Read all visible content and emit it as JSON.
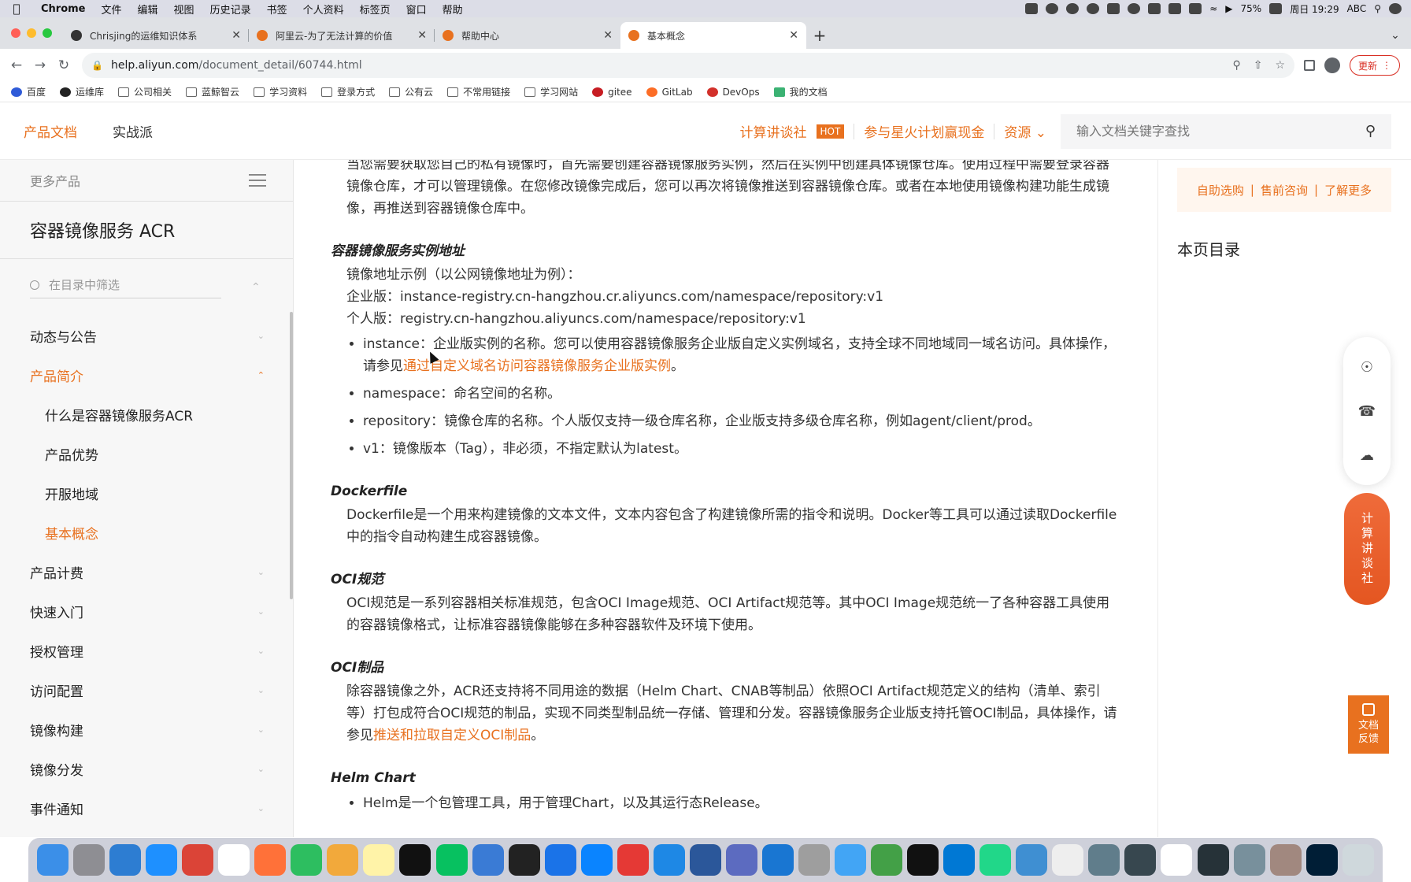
{
  "menubar": {
    "app": "Chrome",
    "items": [
      "文件",
      "编辑",
      "视图",
      "历史记录",
      "书签",
      "个人资料",
      "标签页",
      "窗口",
      "帮助"
    ],
    "battery": "75%",
    "input_method": "ABC",
    "clock": "周日 19:29"
  },
  "tabs": [
    {
      "title": "Chrisjing的运维知识体系",
      "favicon_color": "#333333"
    },
    {
      "title": "阿里云-为了无法计算的价值",
      "favicon_color": "#e8711f"
    },
    {
      "title": "帮助中心",
      "favicon_color": "#e8711f"
    },
    {
      "title": "基本概念",
      "favicon_color": "#e8711f"
    }
  ],
  "address": {
    "host": "help.aliyun.com",
    "path": "/document_detail/60744.html",
    "update_label": "更新"
  },
  "bookmarks": [
    "百度",
    "运维库",
    "公司相关",
    "蓝鲸智云",
    "学习资料",
    "登录方式",
    "公有云",
    "不常用链接",
    "学习网站",
    "gitee",
    "GitLab",
    "DevOps",
    "我的文档"
  ],
  "header": {
    "nav": [
      "产品文档",
      "实战派"
    ],
    "promo1": "计算讲谈社",
    "hot": "HOT",
    "promo2": "参与星火计划赢现金",
    "resources": "资源",
    "search_placeholder": "输入文档关键字查找"
  },
  "sidebar": {
    "more_products": "更多产品",
    "product_title": "容器镜像服务 ACR",
    "filter_placeholder": "在目录中筛选",
    "items": [
      {
        "label": "动态与公告"
      },
      {
        "label": "产品简介"
      },
      {
        "label": "产品计费"
      },
      {
        "label": "快速入门"
      },
      {
        "label": "授权管理"
      },
      {
        "label": "访问配置"
      },
      {
        "label": "镜像构建"
      },
      {
        "label": "镜像分发"
      },
      {
        "label": "事件通知"
      }
    ],
    "sub_items": [
      "什么是容器镜像服务ACR",
      "产品优势",
      "开服地域",
      "基本概念"
    ]
  },
  "content": {
    "intro": "当您需要获取您自己的私有镜像时，首先需要创建容器镜像服务实例，然后在实例中创建具体镜像仓库。使用过程中需要登录容器镜像仓库，才可以管理镜像。在您修改镜像完成后，您可以再次将镜像推送到容器镜像仓库。或者在本地使用镜像构建功能生成镜像，再推送到容器镜像仓库中。",
    "h_instance": "容器镜像服务实例地址",
    "example_intro": "镜像地址示例（以公网镜像地址为例）：",
    "enterprise": "企业版：instance-registry.cn-hangzhou.cr.aliyuncs.com/namespace/repository:v1",
    "personal": "个人版：registry.cn-hangzhou.aliyuncs.com/namespace/repository:v1",
    "li_instance": "instance：企业版实例的名称。您可以使用容器镜像服务企业版自定义实例域名，支持全球不同地域同一域名访问。具体操作，请参见",
    "li_instance_link": "通过自定义域名访问容器镜像服务企业版实例",
    "li_namespace": "namespace：命名空间的名称。",
    "li_repository": "repository：镜像仓库的名称。个人版仅支持一级仓库名称，企业版支持多级仓库名称，例如agent/client/prod。",
    "li_v1": "v1：镜像版本（Tag），非必须，不指定默认为latest。",
    "h_dockerfile": "Dockerfile",
    "dockerfile": "Dockerfile是一个用来构建镜像的文本文件，文本内容包含了构建镜像所需的指令和说明。Docker等工具可以通过读取Dockerfile中的指令自动构建生成容器镜像。",
    "h_oci": "OCI规范",
    "oci": "OCI规范是一系列容器相关标准规范，包含OCI Image规范、OCI Artifact规范等。其中OCI Image规范统一了各种容器工具使用的容器镜像格式，让标准容器镜像能够在多种容器软件及环境下使用。",
    "h_oci_artifact": "OCI制品",
    "oci_artifact": "除容器镜像之外，ACR还支持将不同用途的数据（Helm Chart、CNAB等制品）依照OCI Artifact规范定义的结构（清单、索引等）打包成符合OCI规范的制品，实现不同类型制品统一存储、管理和分发。容器镜像服务企业版支持托管OCI制品，具体操作，请参见",
    "oci_artifact_link": "推送和拉取自定义OCI制品",
    "h_helm": "Helm Chart",
    "li_helm": "Helm是一个包管理工具，用于管理Chart，以及其运行态Release。"
  },
  "right": {
    "links": [
      "自助选购",
      "售前咨询",
      "了解更多"
    ],
    "toc_title": "本页目录",
    "talk": "计算讲谈社",
    "feedback": "文档反馈"
  },
  "colors": {
    "accent": "#e8711f",
    "tab_bar": "#dfe1e5",
    "menubar": "#dcdde7"
  }
}
